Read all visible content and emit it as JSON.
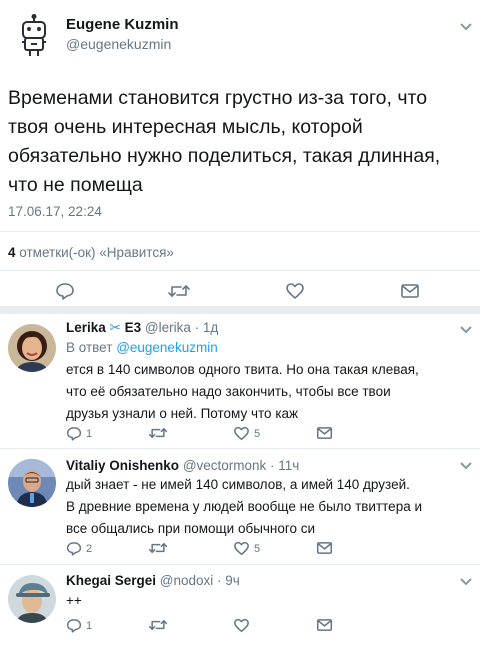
{
  "main_tweet": {
    "author_name": "Eugene Kuzmin",
    "author_handle": "@eugenekuzmin",
    "text": "Временами становится грустно из-за того, что твоя очень интересная мысль, которой обязательно нужно поделиться, такая длинная, что не помеща",
    "text_lines": [
      "Временами становится грустно из-за того, что",
      "твоя очень интересная мысль, которой",
      "обязательно нужно поделиться, такая длинная,",
      "что не помеща"
    ],
    "timestamp": "17.06.17, 22:24",
    "likes_count": "4",
    "likes_label": "отметки(-ок) «Нравится»"
  },
  "replies": [
    {
      "author_name": "Lerika",
      "author_suffix": "E3",
      "meta": "@lerika · 1д",
      "reply_to_prefix": "В ответ",
      "reply_to_handle": "@eugenekuzmin",
      "lines": [
        "ется в 140 символов одного твита. Но она такая клевая,",
        "что её обязательно надо закончить, чтобы все твои",
        "друзья узнали о ней. Потому что каж"
      ],
      "reply_count": "1",
      "retweet_count": "",
      "like_count": "5"
    },
    {
      "author_name": "Vitaliy Onishenko",
      "meta": "@vectormonk · 11ч",
      "lines": [
        "дый знает - не имей 140 символов, а имей 140 друзей.",
        "В древние времена у людей вообще не было твиттера и",
        "все общались при помощи обычного си"
      ],
      "reply_count": "2",
      "retweet_count": "",
      "like_count": "5"
    },
    {
      "author_name": "Khegai Sergei",
      "meta": "@nodoxi · 9ч",
      "lines": [
        "++"
      ],
      "reply_count": "1",
      "retweet_count": "",
      "like_count": ""
    }
  ],
  "icons": {
    "reply": "reply-icon",
    "retweet": "retweet-icon",
    "like": "heart-icon",
    "dm": "envelope-icon",
    "menu": "chevron-down-icon",
    "avatar_robot": "robot-avatar"
  },
  "colors": {
    "text": "#14171a",
    "secondary": "#657786",
    "link": "#1da1f2",
    "divider": "#e6ecf0"
  }
}
